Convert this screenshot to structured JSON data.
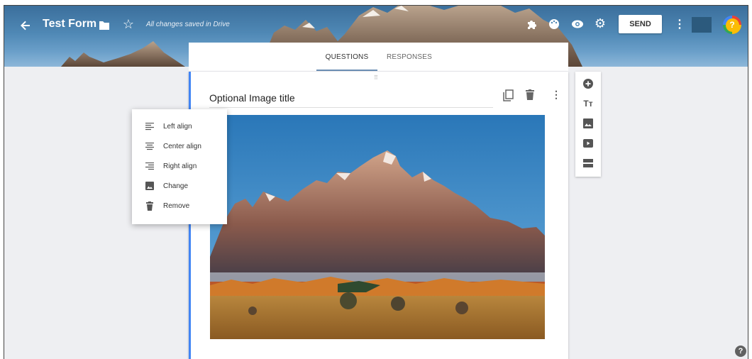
{
  "header": {
    "title": "Test Form",
    "save_status": "All changes saved in Drive",
    "send_label": "SEND",
    "icons": [
      "back-arrow-icon",
      "folder-icon",
      "star-icon",
      "puzzle-icon",
      "palette-icon",
      "eye-icon",
      "gear-icon",
      "more-vert-icon",
      "help-icon"
    ]
  },
  "tabs": [
    {
      "label": "QUESTIONS",
      "selected": true
    },
    {
      "label": "RESPONSES",
      "selected": false
    }
  ],
  "card": {
    "image_title": "Optional Image title",
    "icons": [
      "copy-icon",
      "trash-icon",
      "more-vert-icon"
    ],
    "accent": "#4285f4"
  },
  "menu": {
    "items": [
      {
        "label": "Left align",
        "icon": "align-left-icon"
      },
      {
        "label": "Center align",
        "icon": "align-center-icon"
      },
      {
        "label": "Right align",
        "icon": "align-right-icon"
      },
      {
        "label": "Change",
        "icon": "image-icon"
      },
      {
        "label": "Remove",
        "icon": "trash-icon"
      }
    ]
  },
  "toolbar": {
    "icons": [
      "add-question-icon",
      "add-title-icon",
      "add-image-icon",
      "add-video-icon",
      "add-section-icon"
    ],
    "title_glyph": "Tт"
  },
  "colors": {
    "background": "#eeeff2",
    "tab_underline": "#6b8fb5"
  }
}
